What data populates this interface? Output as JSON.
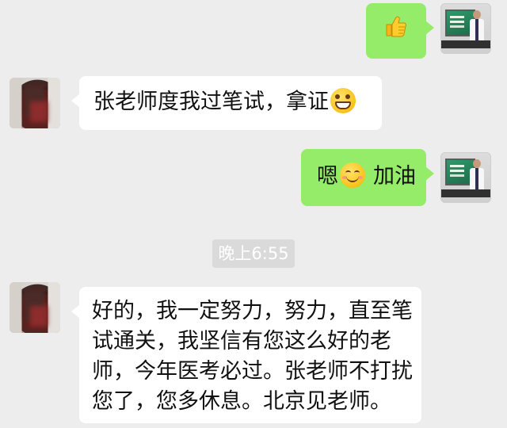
{
  "chat": {
    "messages": [
      {
        "side": "right",
        "type": "emoji",
        "icon": "thumbs-up-icon"
      },
      {
        "side": "left",
        "type": "text",
        "text": "张老师度我过笔试，拿证",
        "emoji": "grinning-face-icon"
      },
      {
        "side": "right",
        "type": "text",
        "text_before": "嗯",
        "emoji": "smiling-face-icon",
        "text_after": "加油"
      },
      {
        "side": "left",
        "type": "text",
        "lines": [
          "好的，我一定努力，努力，直至笔",
          "试通关，我坚信有您这么好的老",
          "师，今年医考必过。张老师不打扰",
          "您了，您多休息。北京见老师。"
        ]
      }
    ],
    "timestamp": "晚上6:55"
  },
  "colors": {
    "background": "#ededed",
    "self_bubble": "#95ec69",
    "other_bubble": "#ffffff",
    "timestamp_bg": "#dadada"
  }
}
